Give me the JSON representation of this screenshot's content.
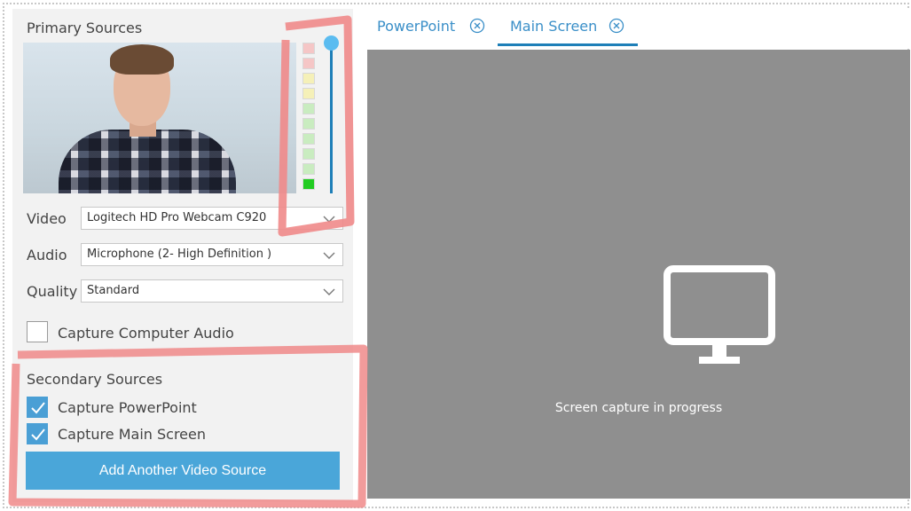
{
  "primary": {
    "title": "Primary Sources",
    "video_label": "Video",
    "video_value": "Logitech HD Pro Webcam C920",
    "audio_label": "Audio",
    "audio_value": "Microphone (2- High Definition )",
    "quality_label": "Quality",
    "quality_value": "Standard",
    "capture_audio_label": "Capture Computer Audio",
    "capture_audio_checked": false
  },
  "secondary": {
    "title": "Secondary Sources",
    "items": [
      {
        "label": "Capture PowerPoint",
        "checked": true
      },
      {
        "label": "Capture Main Screen",
        "checked": true
      }
    ],
    "add_button": "Add Another Video Source"
  },
  "tabs": [
    {
      "label": "PowerPoint",
      "active": false
    },
    {
      "label": "Main Screen",
      "active": true
    }
  ],
  "canvas": {
    "message": "Screen capture in progress"
  },
  "audio_meter": {
    "segments": [
      "#f5c6c6",
      "#f5c6c6",
      "#f5f0b8",
      "#f5f0b8",
      "#c9ecc0",
      "#c9ecc0",
      "#c9ecc0",
      "#c9ecc0",
      "#c9ecc0",
      "#22cc22"
    ]
  },
  "colors": {
    "accent": "#4aa6d9",
    "highlight": "#f08a8a"
  }
}
